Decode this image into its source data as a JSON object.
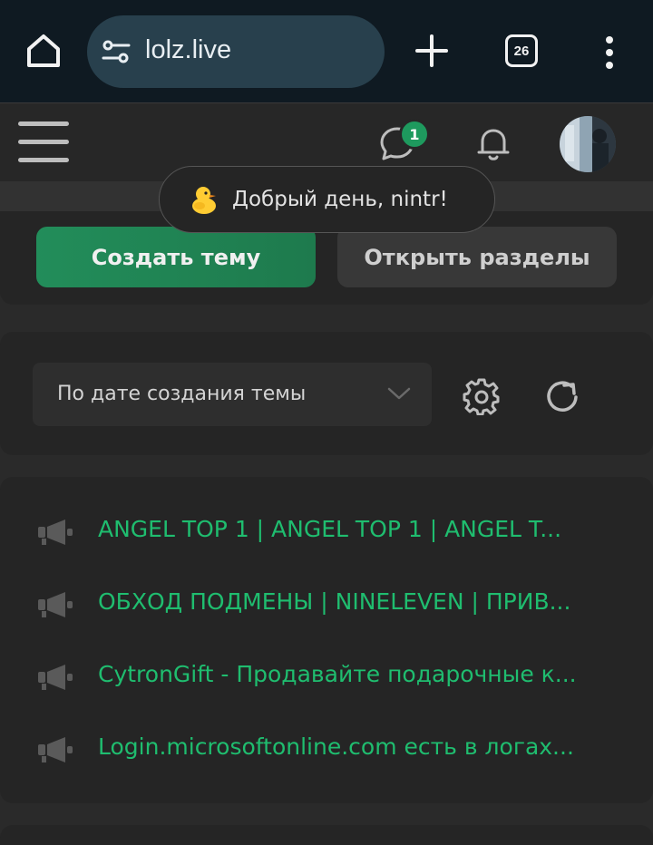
{
  "browser": {
    "url": "lolz.live",
    "tab_count": "26",
    "colors": {
      "bar": "#0f1a22",
      "url_box": "#28404d"
    }
  },
  "header": {
    "chat_badge_count": "1",
    "icons": [
      "hamburger-icon",
      "chat-icon",
      "bell-icon",
      "avatar"
    ]
  },
  "greeting": {
    "text": "Добрый день, nintr!",
    "emoji_icon": "duck-icon"
  },
  "actions": {
    "create_label": "Создать тему",
    "open_label": "Открыть разделы",
    "accent": "#1e9a5e"
  },
  "sort": {
    "selected": "По дате создания темы"
  },
  "threads": [
    {
      "title": "ANGEL TOP 1 | ANGEL TOP 1 | ANGEL T..."
    },
    {
      "title": "ОБХОД ПОДМЕНЫ | NINELEVEN | ПРИВ..."
    },
    {
      "title": "CytronGift - Продавайте подарочные к..."
    },
    {
      "title": "Login.microsoftonline.com есть в логах..."
    }
  ],
  "colors": {
    "page_bg": "#2a2a2a",
    "panel_bg": "#252525",
    "link_green": "#1fbd6f"
  }
}
